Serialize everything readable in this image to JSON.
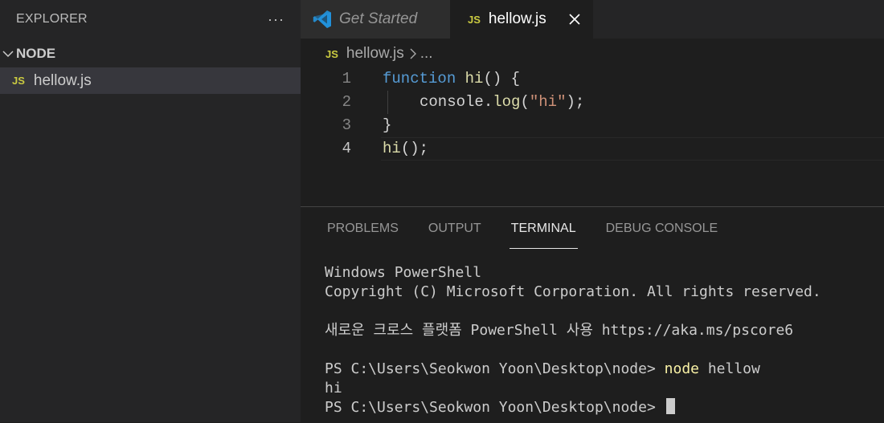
{
  "sidebar": {
    "title": "EXPLORER",
    "more": "···",
    "section": "NODE",
    "file": {
      "badge": "JS",
      "label": "hellow.js"
    }
  },
  "tabs": [
    {
      "label": "Get Started",
      "icon": "vscode-logo-icon"
    },
    {
      "badge": "JS",
      "label": "hellow.js",
      "close": "close-icon"
    }
  ],
  "breadcrumb": {
    "badge": "JS",
    "file": "hellow.js",
    "more": "..."
  },
  "editor": {
    "line_numbers": [
      "1",
      "2",
      "3",
      "4"
    ],
    "active_line": "4",
    "lines": [
      {
        "t1": "function",
        "t2": " hi",
        "t3": "() {"
      },
      {
        "t1": "console",
        "t2": ".",
        "t3": "log",
        "t4": "(",
        "t5": "\"hi\"",
        "t6": ");"
      },
      {
        "t1": "}"
      },
      {
        "t1": "hi",
        "t2": "();"
      }
    ]
  },
  "panel": {
    "tabs": [
      "PROBLEMS",
      "OUTPUT",
      "TERMINAL",
      "DEBUG CONSOLE"
    ],
    "active_tab": "TERMINAL"
  },
  "terminal": {
    "lines": [
      "Windows PowerShell",
      "Copyright (C) Microsoft Corporation. All rights reserved.",
      "",
      "새로운 크로스 플랫폼 PowerShell 사용 https://aka.ms/pscore6",
      ""
    ],
    "prompt1": "PS C:\\Users\\Seokwon Yoon\\Desktop\\node> ",
    "command": "node",
    "command_arg": " hellow",
    "output": "hi",
    "prompt2": "PS C:\\Users\\Seokwon Yoon\\Desktop\\node> "
  },
  "colors": {
    "accent_js": "#cbcb41",
    "keyword": "#569cd6",
    "string": "#ce9178",
    "function": "#dcdcaa",
    "command": "#f9f1a5"
  }
}
